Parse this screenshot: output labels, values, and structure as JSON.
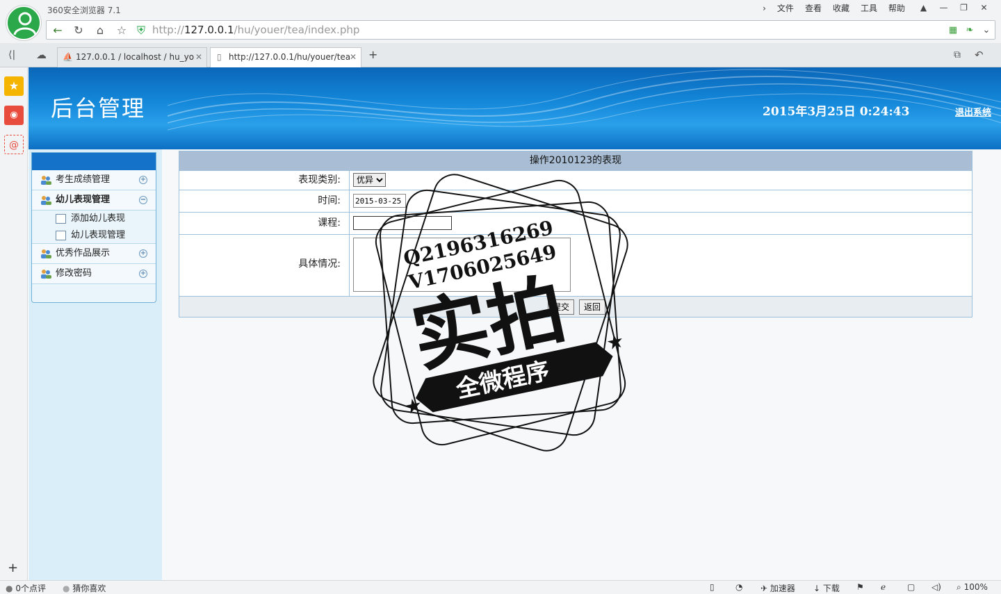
{
  "browser": {
    "title": "360安全浏览器 7.1",
    "menu": [
      "文件",
      "查看",
      "收藏",
      "工具",
      "帮助"
    ],
    "url_prefix": "http://",
    "url_host": "127.0.0.1",
    "url_path": "/hu/youer/tea/index.php",
    "tabs": [
      {
        "label": "127.0.0.1 / localhost / hu_yo",
        "active": false
      },
      {
        "label": "http://127.0.0.1/hu/youer/tea",
        "active": true
      }
    ],
    "new_tab": "+"
  },
  "status_bar": {
    "comments": "0个点评",
    "guess": "猜你喜欢",
    "accelerator": "加速器",
    "download": "下载",
    "zoom": "100%"
  },
  "header": {
    "title": "后台管理",
    "datetime": "2015年3月25日  0:24:43",
    "logout": "退出系统"
  },
  "sidebar": {
    "items": [
      {
        "label": "考生成绩管理",
        "expanded": false
      },
      {
        "label": "幼儿表现管理",
        "expanded": true,
        "children": [
          "添加幼儿表现",
          "幼儿表现管理"
        ]
      },
      {
        "label": "优秀作品展示",
        "expanded": false
      },
      {
        "label": "修改密码",
        "expanded": false
      }
    ]
  },
  "form": {
    "caption": "操作2010123的表现",
    "type_label": "表现类别:",
    "type_value": "优异",
    "date_label": "时间:",
    "date_value": "2015-03-25",
    "course_label": "课程:",
    "course_value": "",
    "detail_label": "具体情况:",
    "detail_value": "",
    "submit": "提交",
    "back": "返回"
  },
  "watermark": {
    "line1": "Q2196316269",
    "line2": "V1706025649",
    "big": "实拍",
    "banner": "全微程序"
  },
  "colors": {
    "header_blue": "#1386d8",
    "sidebar_bg": "#d9eef8",
    "caption_bg": "#a9bed4",
    "avatar_green": "#2aa84a"
  }
}
